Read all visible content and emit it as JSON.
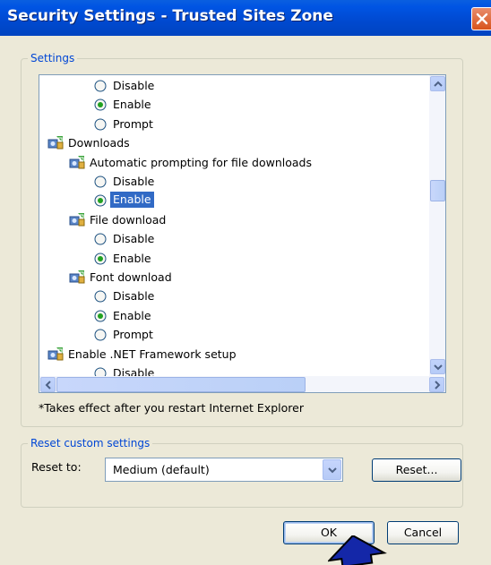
{
  "window": {
    "title": "Security Settings - Trusted Sites Zone"
  },
  "settings_group": {
    "legend": "Settings",
    "tree": [
      {
        "kind": "radio",
        "label": "Disable",
        "checked": false,
        "selected": false,
        "indent": 2
      },
      {
        "kind": "radio",
        "label": "Enable",
        "checked": true,
        "selected": false,
        "indent": 2
      },
      {
        "kind": "radio",
        "label": "Prompt",
        "checked": false,
        "selected": false,
        "indent": 2
      },
      {
        "kind": "category",
        "label": "Downloads",
        "indent": 0
      },
      {
        "kind": "category",
        "label": "Automatic prompting for file downloads",
        "indent": 1
      },
      {
        "kind": "radio",
        "label": "Disable",
        "checked": false,
        "selected": false,
        "indent": 2
      },
      {
        "kind": "radio",
        "label": "Enable",
        "checked": true,
        "selected": true,
        "indent": 2
      },
      {
        "kind": "category",
        "label": "File download",
        "indent": 1
      },
      {
        "kind": "radio",
        "label": "Disable",
        "checked": false,
        "selected": false,
        "indent": 2
      },
      {
        "kind": "radio",
        "label": "Enable",
        "checked": true,
        "selected": false,
        "indent": 2
      },
      {
        "kind": "category",
        "label": "Font download",
        "indent": 1
      },
      {
        "kind": "radio",
        "label": "Disable",
        "checked": false,
        "selected": false,
        "indent": 2
      },
      {
        "kind": "radio",
        "label": "Enable",
        "checked": true,
        "selected": false,
        "indent": 2
      },
      {
        "kind": "radio",
        "label": "Prompt",
        "checked": false,
        "selected": false,
        "indent": 2
      },
      {
        "kind": "category",
        "label": "Enable .NET Framework setup",
        "indent": 0
      },
      {
        "kind": "radio",
        "label": "Disable",
        "checked": false,
        "selected": false,
        "indent": 2
      }
    ],
    "note": "*Takes effect after you restart Internet Explorer"
  },
  "reset_group": {
    "legend": "Reset custom settings",
    "reset_to_label": "Reset to:",
    "reset_to_value": "Medium (default)",
    "reset_button": "Reset..."
  },
  "buttons": {
    "ok": "OK",
    "cancel": "Cancel"
  },
  "colors": {
    "titlebar": "#0054e3",
    "selection": "#316ac5",
    "group_legend": "#0046d5",
    "dialog_bg": "#ece9d8"
  },
  "icons": {
    "close": "close-icon",
    "category": "settings-category-icon",
    "scroll_up": "chevron-up-icon",
    "scroll_down": "chevron-down-icon",
    "scroll_left": "chevron-left-icon",
    "scroll_right": "chevron-right-icon",
    "combo": "chevron-down-icon",
    "pointer": "arrow-cursor-icon"
  }
}
